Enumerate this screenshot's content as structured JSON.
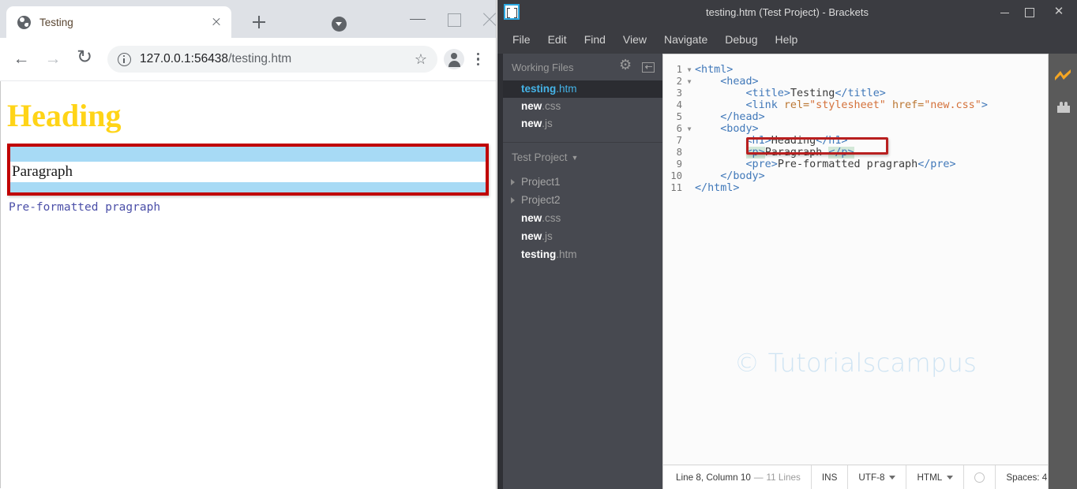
{
  "browser": {
    "tab": {
      "title": "Testing",
      "favicon_icon": "globe-icon",
      "close_icon": "close-icon"
    },
    "new_tab_icon": "plus-icon",
    "tab_list_icon": "caret-down-circle-icon",
    "window_controls": {
      "minimize": "minimize-icon",
      "maximize": "maximize-icon",
      "close": "close-icon"
    },
    "nav": {
      "back_icon": "arrow-back-icon",
      "forward_icon": "arrow-forward-icon",
      "reload_icon": "reload-icon",
      "info_icon": "info-circle-icon",
      "url_host": "127.0.0.1:56438",
      "url_path": "/testing.htm",
      "bookmark_icon": "star-icon",
      "profile_icon": "avatar-icon",
      "menu_icon": "kebab-menu-icon"
    },
    "page": {
      "heading": "Heading",
      "paragraph": "Paragraph",
      "preformatted": "Pre-formatted pragraph",
      "heading_color": "#FFD417",
      "paragraph_bg_color": "#A7DAF5",
      "highlight_border_color": "#C00000",
      "pre_color": "#4b4fa8"
    }
  },
  "brackets": {
    "title": "testing.htm (Test Project) - Brackets",
    "logo_icon": "brackets-logo-icon",
    "window_controls": {
      "minimize": "minimize-icon",
      "maximize": "maximize-icon",
      "close": "close-icon"
    },
    "menus": [
      "File",
      "Edit",
      "Find",
      "View",
      "Navigate",
      "Debug",
      "Help"
    ],
    "sidebar": {
      "working_files_label": "Working Files",
      "gear_icon": "gear-icon",
      "split_icon": "split-view-icon",
      "working_files": [
        {
          "base": "testing",
          "ext": ".htm",
          "selected": true
        },
        {
          "base": "new",
          "ext": ".css",
          "selected": false
        },
        {
          "base": "new",
          "ext": ".js",
          "selected": false
        }
      ],
      "project_name": "Test Project",
      "project_caret_icon": "caret-down-icon",
      "tree": [
        {
          "name": "Project1",
          "type": "folder"
        },
        {
          "name": "Project2",
          "type": "folder"
        },
        {
          "base": "new",
          "ext": ".css",
          "type": "file"
        },
        {
          "base": "new",
          "ext": ".js",
          "type": "file"
        },
        {
          "base": "testing",
          "ext": ".htm",
          "type": "file"
        }
      ]
    },
    "editor": {
      "watermark": "© Tutorialscampus",
      "highlight_border_color": "#B81F1F",
      "lines": [
        {
          "n": "1",
          "fold": "▼",
          "segments": [
            {
              "c": "t",
              "v": "<html>"
            }
          ]
        },
        {
          "n": "2",
          "fold": "▼",
          "segments": [
            {
              "c": "",
              "v": "    "
            },
            {
              "c": "t",
              "v": "<head>"
            }
          ]
        },
        {
          "n": "3",
          "fold": "",
          "segments": [
            {
              "c": "",
              "v": "        "
            },
            {
              "c": "t",
              "v": "<title>"
            },
            {
              "c": "",
              "v": "Testing"
            },
            {
              "c": "t",
              "v": "</title>"
            }
          ]
        },
        {
          "n": "4",
          "fold": "",
          "segments": [
            {
              "c": "",
              "v": "        "
            },
            {
              "c": "t",
              "v": "<link "
            },
            {
              "c": "an",
              "v": "rel="
            },
            {
              "c": "av",
              "v": "\"stylesheet\""
            },
            {
              "c": "",
              "v": " "
            },
            {
              "c": "an",
              "v": "href="
            },
            {
              "c": "av",
              "v": "\"new.css\""
            },
            {
              "c": "t",
              "v": ">"
            }
          ]
        },
        {
          "n": "5",
          "fold": "",
          "segments": [
            {
              "c": "",
              "v": "    "
            },
            {
              "c": "t",
              "v": "</head>"
            }
          ]
        },
        {
          "n": "6",
          "fold": "▼",
          "segments": [
            {
              "c": "",
              "v": "    "
            },
            {
              "c": "t",
              "v": "<body>"
            }
          ]
        },
        {
          "n": "7",
          "fold": "",
          "segments": [
            {
              "c": "",
              "v": "        "
            },
            {
              "c": "t",
              "v": "<h1>"
            },
            {
              "c": "",
              "v": "Heading"
            },
            {
              "c": "t",
              "v": "</h1>"
            }
          ]
        },
        {
          "n": "8",
          "fold": "",
          "segments": [
            {
              "c": "",
              "v": "        "
            },
            {
              "c": "t hl",
              "v": "<p>"
            },
            {
              "c": "",
              "v": "Paragraph "
            },
            {
              "c": "t hl",
              "v": "</p>"
            }
          ]
        },
        {
          "n": "9",
          "fold": "",
          "segments": [
            {
              "c": "",
              "v": "        "
            },
            {
              "c": "t",
              "v": "<pre>"
            },
            {
              "c": "",
              "v": "Pre-formatted pragraph"
            },
            {
              "c": "t",
              "v": "</pre>"
            }
          ]
        },
        {
          "n": "10",
          "fold": "",
          "segments": [
            {
              "c": "",
              "v": "    "
            },
            {
              "c": "t",
              "v": "</body>"
            }
          ]
        },
        {
          "n": "11",
          "fold": "",
          "segments": [
            {
              "c": "t",
              "v": "</html>"
            }
          ]
        }
      ]
    },
    "statusbar": {
      "cursor": "Line 8, Column 10",
      "dash": "—",
      "lines": "11 Lines",
      "insert_mode": "INS",
      "encoding": "UTF-8",
      "language": "HTML",
      "lint_icon": "lint-status-icon",
      "indent": "Spaces:",
      "indent_size": "4"
    },
    "toolbar": {
      "live_preview_icon": "live-preview-bolt-icon",
      "extension_manager_icon": "extension-manager-brick-icon",
      "live_preview_color": "#f5a623"
    }
  }
}
